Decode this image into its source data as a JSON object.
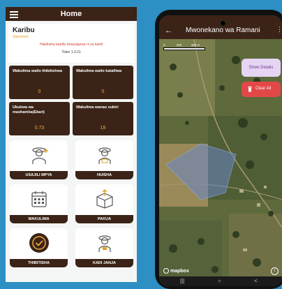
{
  "home": {
    "title": "Home",
    "greeting": "Karibu",
    "role": "Staramani",
    "warning": "Hakikisha taarifa zinazojazwa ni za kweli",
    "version": "Toleo 1.3.21"
  },
  "stats": [
    {
      "label": "Wakulima walio thibitishwa",
      "value": "0"
    },
    {
      "label": "Wakulima walio katalliwa",
      "value": "0"
    },
    {
      "label": "Ukubwa wa mashamba(Ekari)",
      "value": "0.73"
    },
    {
      "label": "Wakulima wanao subiri",
      "value": "18"
    }
  ],
  "tiles": [
    {
      "label": "USAJILI MPYA",
      "icon": "farmer-add-icon"
    },
    {
      "label": "HUISHA",
      "icon": "farmer-update-icon"
    },
    {
      "label": "WAKULIMA",
      "icon": "calendar-icon"
    },
    {
      "label": "PAKUA",
      "icon": "box-upload-icon"
    },
    {
      "label": "THIBITISHA",
      "icon": "check-circle-icon"
    },
    {
      "label": "KADI JANJA",
      "icon": "farmer-card-icon"
    }
  ],
  "map_screen": {
    "title": "Mwonekano wa Ramani",
    "scale_labels": [
      "0",
      "200",
      "400 m"
    ],
    "details_button": "Show Details",
    "clear_button": "Clear All",
    "attribution": "mapbox"
  },
  "colors": {
    "primary": "#3b2317",
    "accent": "#f2a93b",
    "background": "#2d8fc4",
    "clear": "#e34848",
    "details": "#e6d4f3"
  }
}
